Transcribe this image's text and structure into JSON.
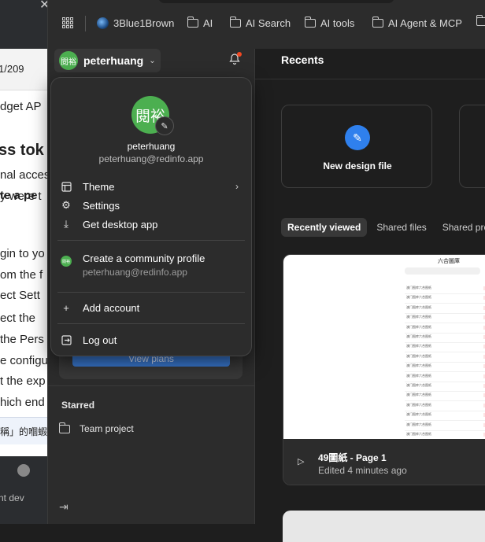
{
  "background_window": {
    "fragments": [
      "1/209",
      "dget AP",
      "ss tok",
      "nal acces",
      "y were t",
      "te a pe",
      "gin to yo",
      "om the f",
      "ect Sett",
      "ect the",
      "the Pers",
      "e configu",
      "t the exp",
      "hich end",
      "稱」的嗰蝦",
      "nt dev"
    ]
  },
  "bookmarks": [
    "3Blue1Brown",
    "AI",
    "AI Search",
    "AI tools",
    "AI Agent & MCP"
  ],
  "sidebar": {
    "username": "peterhuang",
    "avatar_text": "閱裕",
    "view_plans": "View plans",
    "starred_heading": "Starred",
    "team_project": "Team project"
  },
  "menu": {
    "name": "peterhuang",
    "email": "peterhuang@redinfo.app",
    "items": {
      "theme": "Theme",
      "settings": "Settings",
      "desktop": "Get desktop app",
      "community": "Create a community profile",
      "community_email": "peterhuang@redinfo.app",
      "add_account": "Add account",
      "logout": "Log out"
    }
  },
  "main": {
    "title": "Recents",
    "new_design": "New design file",
    "tabs": [
      "Recently viewed",
      "Shared files",
      "Shared proj"
    ],
    "file": {
      "name": "49圖紙 - Page 1",
      "edited": "Edited 4 minutes ago",
      "thumb_title": "六合圖庫",
      "thumb_row_text": "澳门图库六合图纸"
    }
  },
  "colors": {
    "accent": "#2f80ed",
    "avatar": "#4caf50",
    "notification": "#f24822"
  }
}
